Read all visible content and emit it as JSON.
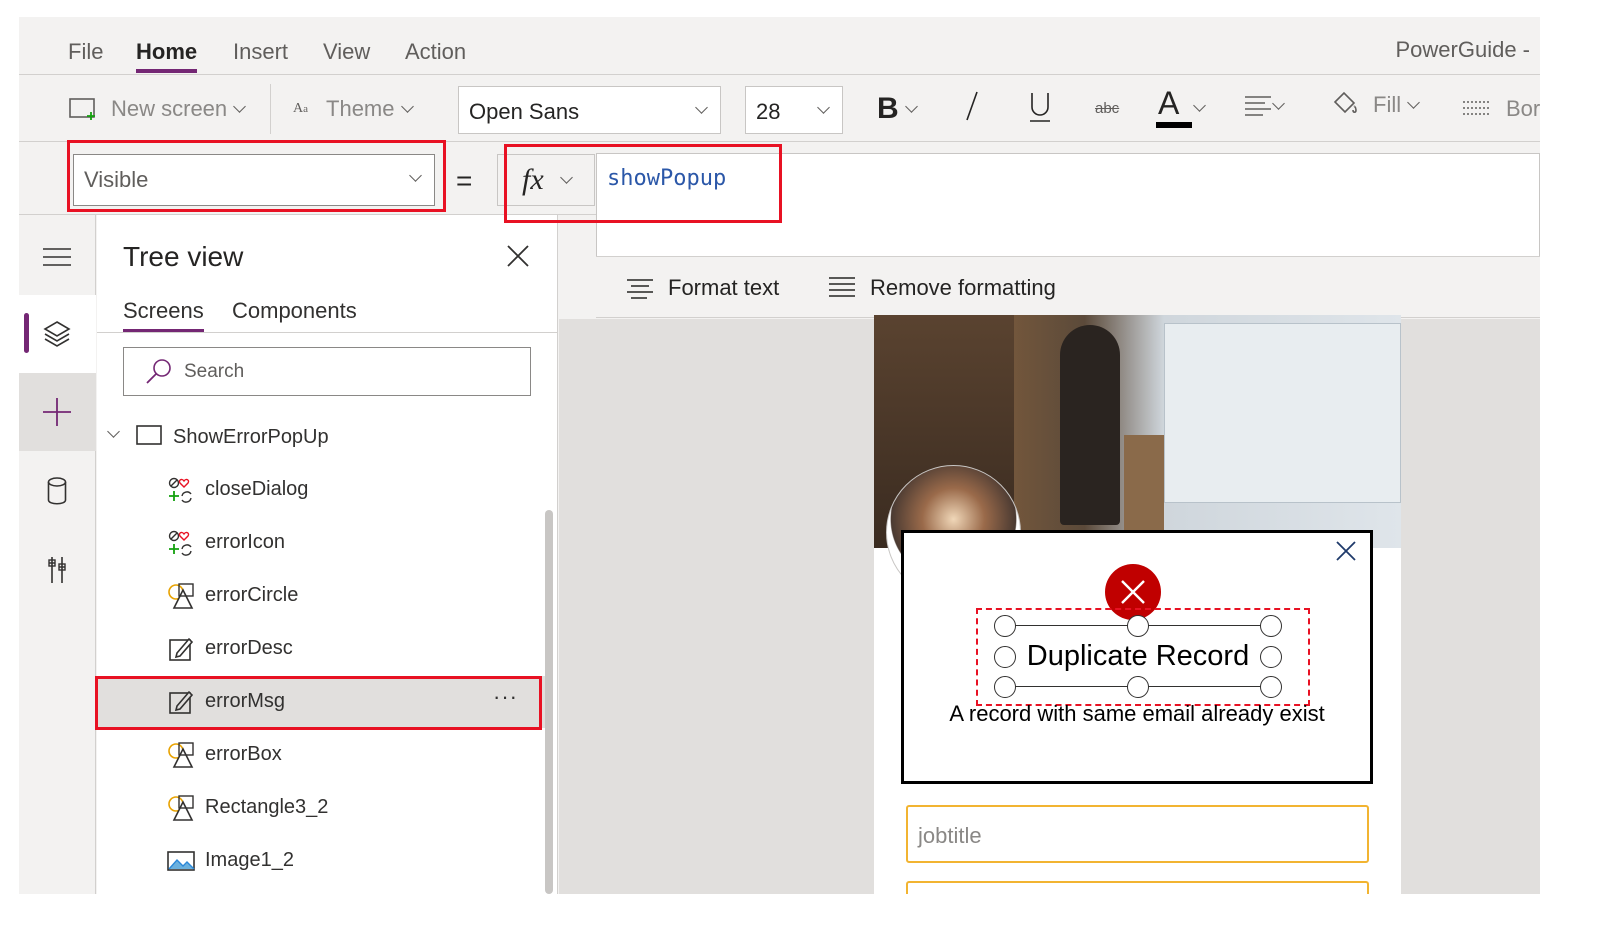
{
  "menubar": {
    "items": [
      "File",
      "Home",
      "Insert",
      "View",
      "Action"
    ],
    "active": "Home",
    "app_name": "PowerGuide -"
  },
  "ribbon": {
    "new_screen": "New screen",
    "theme": "Theme",
    "font": "Open Sans",
    "font_size": "28",
    "bold": "B",
    "fill": "Fill",
    "border": "Bor"
  },
  "formula": {
    "property": "Visible",
    "equals": "=",
    "fx": "fx",
    "expression": "showPopup",
    "format_text": "Format text",
    "remove_formatting": "Remove formatting"
  },
  "tree": {
    "title": "Tree view",
    "tabs": [
      "Screens",
      "Components"
    ],
    "search_placeholder": "Search",
    "screen_name": "ShowErrorPopUp",
    "nodes": [
      {
        "label": "closeDialog",
        "icon": "icons-control-icon"
      },
      {
        "label": "errorIcon",
        "icon": "icons-control-icon"
      },
      {
        "label": "errorCircle",
        "icon": "shapes-icon"
      },
      {
        "label": "errorDesc",
        "icon": "label-edit-icon"
      },
      {
        "label": "errorMsg",
        "icon": "label-edit-icon",
        "selected": true
      },
      {
        "label": "errorBox",
        "icon": "shapes-icon"
      },
      {
        "label": "Rectangle3_2",
        "icon": "shapes-icon"
      },
      {
        "label": "Image1_2",
        "icon": "image-icon"
      }
    ],
    "more": "···"
  },
  "canvas": {
    "popup_title": "Duplicate Record",
    "popup_desc": "A record with same email already exist",
    "input_placeholder": "jobtitle"
  },
  "colors": {
    "accent": "#742774",
    "highlight": "#e81123",
    "error": "#c00000",
    "input_border": "#f2b431"
  }
}
